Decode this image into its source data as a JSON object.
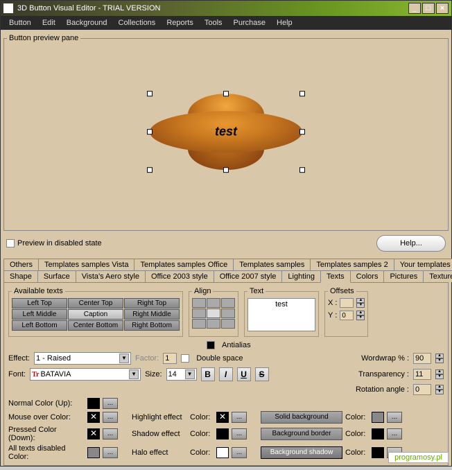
{
  "title": "3D Button Visual Editor - TRIAL VERSION",
  "menu": [
    "Button",
    "Edit",
    "Background",
    "Collections",
    "Reports",
    "Tools",
    "Purchase",
    "Help"
  ],
  "preview": {
    "legend": "Button preview pane",
    "buttonText": "test",
    "disabledLabel": "Preview in disabled state",
    "helpLabel": "Help..."
  },
  "tabsRow1": [
    "Others",
    "Templates samples Vista",
    "Templates samples Office",
    "Templates samples",
    "Templates samples 2",
    "Your templates"
  ],
  "tabsRow2": [
    "Shape",
    "Surface",
    "Vista's Aero style",
    "Office 2003 style",
    "Office 2007 style",
    "Lighting",
    "Texts",
    "Colors",
    "Pictures",
    "Textures"
  ],
  "activeTab": "Texts",
  "availTexts": {
    "legend": "Available texts",
    "items": [
      "Left Top",
      "Center Top",
      "Right Top",
      "Left Middle",
      "Caption",
      "Right Middle",
      "Left Bottom",
      "Center Bottom",
      "Right Bottom"
    ]
  },
  "align": {
    "legend": "Align"
  },
  "text": {
    "legend": "Text",
    "value": "test"
  },
  "offsets": {
    "legend": "Offsets",
    "xLabel": "X :",
    "xVal": "",
    "yLabel": "Y :",
    "yVal": "0"
  },
  "antialias": "Antialias",
  "doubleSpace": "Double space",
  "effectLabel": "Effect:",
  "effectValue": "1 - Raised",
  "factorLabel": "Factor:",
  "factorValue": "1",
  "wordwrapLabel": "Wordwrap % :",
  "wordwrapValue": "90",
  "fontLabel": "Font:",
  "fontValue": "BATAVIA",
  "sizeLabel": "Size:",
  "sizeValue": "14",
  "transparencyLabel": "Transparency :",
  "transparencyValue": "11",
  "rotationLabel": "Rotation angle :",
  "rotationValue": "0",
  "colorRows": {
    "normalUp": "Normal Color (Up):",
    "mouseOver": "Mouse over Color:",
    "pressed": "Pressed Color (Down):",
    "disabled": "All texts disabled Color:",
    "highlight": "Highlight effect",
    "shadow": "Shadow effect",
    "halo": "Halo effect",
    "colorLabel": "Color:",
    "solidBg": "Solid background",
    "bgBorder": "Background border",
    "bgShadow": "Background shadow"
  },
  "dots": "...",
  "watermark": "programosy.pl"
}
